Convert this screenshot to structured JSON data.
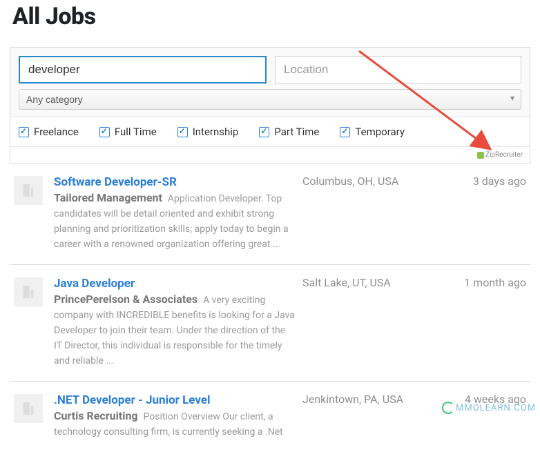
{
  "page": {
    "title": "All Jobs"
  },
  "search": {
    "keyword_value": "developer",
    "location_placeholder": "Location",
    "category_label": "Any category"
  },
  "job_types": [
    {
      "label": "Freelance",
      "checked": true
    },
    {
      "label": "Full Time",
      "checked": true
    },
    {
      "label": "Internship",
      "checked": true
    },
    {
      "label": "Part Time",
      "checked": true
    },
    {
      "label": "Temporary",
      "checked": true
    }
  ],
  "sponsor": {
    "label": "ZipRecruiter"
  },
  "jobs": [
    {
      "title": "Software Developer-SR",
      "company": "Tailored Management",
      "description": "Application Developer. Top candidates will be detail oriented and exhibit strong planning and prioritization skills; apply today to begin a career with a renowned organization offering great ...",
      "location": "Columbus, OH, USA",
      "posted": "3 days ago"
    },
    {
      "title": "Java Developer",
      "company": "PrincePerelson & Associates",
      "description": "A very exciting company with INCREDIBLE benefits is looking for a Java Developer to join their team. Under the direction of the IT Director, this individual is responsible for the timely and reliable ...",
      "location": "Salt Lake, UT, USA",
      "posted": "1 month ago"
    },
    {
      "title": ".NET Developer - Junior Level",
      "company": "Curtis Recruiting",
      "description": "Position Overview Our client, a technology consulting firm, is currently seeking a .Net",
      "location": "Jenkintown, PA, USA",
      "posted": "4 weeks ago"
    }
  ],
  "watermark": {
    "text": "MMOLEARN.COM"
  }
}
